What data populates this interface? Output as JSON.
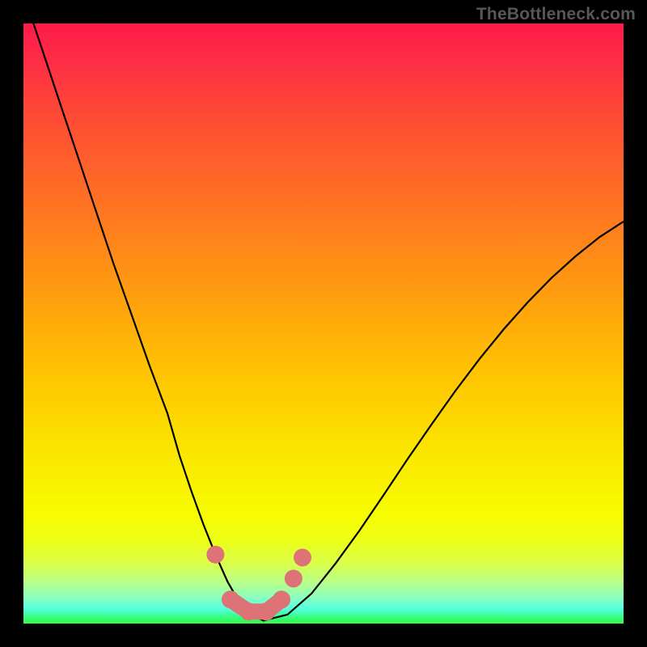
{
  "watermark": "TheBottleneck.com",
  "chart_data": {
    "type": "line",
    "title": "",
    "xlabel": "",
    "ylabel": "",
    "xlim": [
      0,
      100
    ],
    "ylim": [
      0,
      100
    ],
    "series": [
      {
        "name": "bottleneck-curve",
        "x": [
          0,
          3,
          6,
          9,
          12,
          15,
          18,
          21,
          24,
          26,
          28,
          30,
          32,
          34,
          36,
          38,
          40,
          44,
          48,
          52,
          56,
          60,
          64,
          68,
          72,
          76,
          80,
          84,
          88,
          92,
          96,
          100
        ],
        "y": [
          105,
          96,
          87,
          78,
          69,
          60,
          51.5,
          43,
          35,
          28,
          22,
          16.5,
          11.5,
          7,
          3.5,
          1.4,
          0.5,
          1.5,
          5,
          10,
          15.5,
          21.4,
          27.4,
          33.2,
          38.8,
          44.1,
          49,
          53.5,
          57.6,
          61.2,
          64.4,
          67.0
        ]
      }
    ],
    "markers": {
      "name": "highlighted-points",
      "x": [
        32.0,
        34.5,
        37.5,
        40.5,
        43.0,
        45.0,
        46.5
      ],
      "y": [
        11.5,
        4.0,
        2.0,
        2.0,
        4.0,
        7.5,
        11.0
      ]
    },
    "gradient_stops": [
      {
        "pos": 0.0,
        "color": "#fd1a49"
      },
      {
        "pos": 0.3,
        "color": "#ff7222"
      },
      {
        "pos": 0.62,
        "color": "#fecd00"
      },
      {
        "pos": 0.82,
        "color": "#f6fc01"
      },
      {
        "pos": 0.95,
        "color": "#8effbb"
      },
      {
        "pos": 1.0,
        "color": "#33fc41"
      }
    ]
  }
}
